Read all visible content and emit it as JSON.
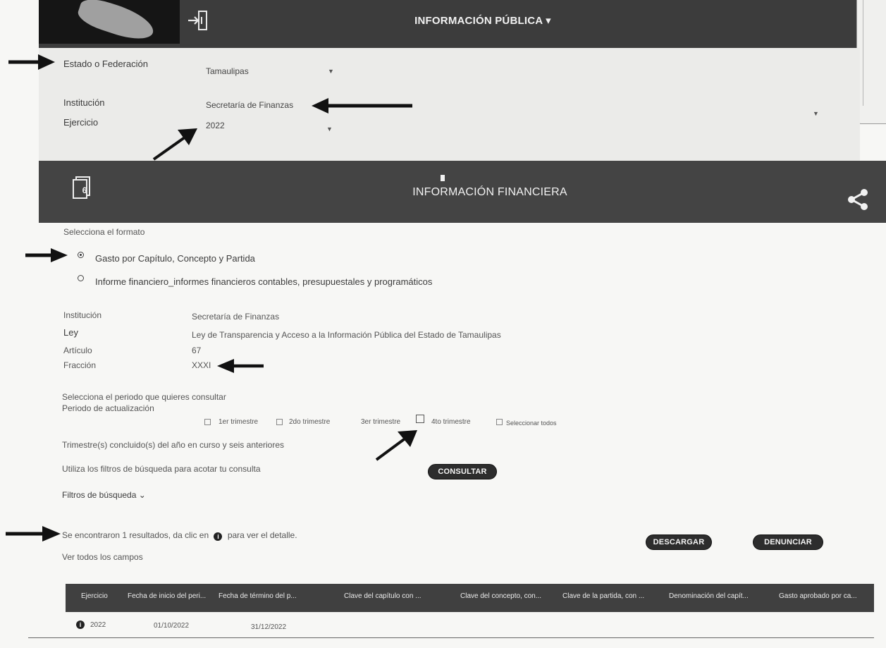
{
  "header": {
    "title": "INFORMACIÓN PÚBLICA",
    "chevron": "▾"
  },
  "filters": {
    "estado_label": "Estado o Federación",
    "estado_value": "Tamaulipas",
    "institucion_label": "Institución",
    "institucion_value": "Secretaría de Finanzas",
    "ejercicio_label": "Ejercicio",
    "ejercicio_value": "2022"
  },
  "section": {
    "title": "INFORMACIÓN FINANCIERA",
    "doc_icon_number": "6"
  },
  "format": {
    "prompt": "Selecciona el formato",
    "options": [
      "Gasto por Capítulo, Concepto y Partida",
      "Informe financiero_informes financieros contables, presupuestales y programáticos"
    ]
  },
  "details": {
    "institucion_label": "Institución",
    "institucion_value": "Secretaría de Finanzas",
    "ley_label": "Ley",
    "ley_value": "Ley de Transparencia y Acceso a la Información Pública del Estado de Tamaulipas",
    "articulo_label": "Artículo",
    "articulo_value": "67",
    "fraccion_label": "Fracción",
    "fraccion_value": "XXXI"
  },
  "period": {
    "prompt": "Selecciona el periodo que quieres consultar",
    "label": "Periodo de actualización",
    "options": [
      "1er trimestre",
      "2do trimestre",
      "3er trimestre",
      "4to trimestre",
      "Seleccionar todos"
    ],
    "note": "Trimestre(s) concluido(s) del año en curso y seis anteriores"
  },
  "search": {
    "hint": "Utiliza los filtros de búsqueda para acotar tu consulta",
    "consult_button": "CONSULTAR",
    "filters_toggle": "Filtros de búsqueda ⌄"
  },
  "results": {
    "count_text_before": "Se encontraron 1 resultados, da clic en",
    "count_text_after": "para ver el detalle.",
    "show_all": "Ver todos los campos",
    "download_button": "DESCARGAR",
    "report_button": "DENUNCIAR"
  },
  "table": {
    "columns": [
      "Ejercicio",
      "Fecha de inicio del peri...",
      "Fecha de término del p...",
      "Clave del capítulo con ...",
      "Clave del concepto, con...",
      "Clave de la partida, con ...",
      "Denominación del capít...",
      "Gasto aprobado por ca..."
    ],
    "rows": [
      {
        "ejercicio": "2022",
        "inicio": "01/10/2022",
        "termino": "31/12/2022"
      }
    ]
  },
  "icons": {
    "login": "login-icon",
    "doc": "document-icon",
    "share": "share-icon",
    "info": "info-icon"
  }
}
